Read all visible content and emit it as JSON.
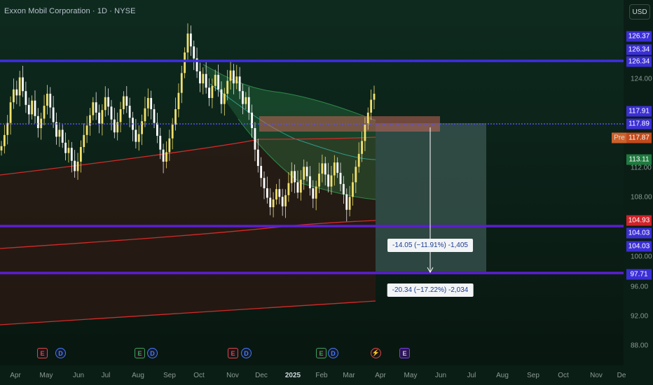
{
  "header": {
    "title": "Exxon Mobil Corporation · 1D · NYSE",
    "currency_button": "USD"
  },
  "price_axis": {
    "ticks": [
      "124.00",
      "112.00",
      "108.00",
      "100.00",
      "96.00",
      "92.00",
      "88.00"
    ],
    "tags": [
      {
        "label": "126.37",
        "color": "#3b2fd6"
      },
      {
        "label": "126.34",
        "color": "#3b2fd6"
      },
      {
        "label": "126.34",
        "color": "#3b2fd6"
      },
      {
        "label": "117.91",
        "color": "#3b2fd6"
      },
      {
        "label": "117.89",
        "color": "#3b2fd6"
      },
      {
        "label": "117.87",
        "color": "#c24a1b"
      },
      {
        "label": "113.11",
        "color": "#1f7a3f"
      },
      {
        "label": "104.93",
        "color": "#d0232a"
      },
      {
        "label": "104.03",
        "color": "#3b2fd6"
      },
      {
        "label": "104.03",
        "color": "#3b2fd6"
      },
      {
        "label": "97.71",
        "color": "#3b2fd6"
      }
    ],
    "pre_label": "Pre"
  },
  "time_axis": {
    "ticks": [
      "Apr",
      "May",
      "Jun",
      "Jul",
      "Aug",
      "Sep",
      "Oct",
      "Nov",
      "Dec",
      "2025",
      "Feb",
      "Mar",
      "Apr",
      "May",
      "Jun",
      "Jul",
      "Aug",
      "Sep",
      "Oct",
      "Nov",
      "De"
    ]
  },
  "measurements": [
    {
      "label": "-14.05 (−11.91%) -1,405"
    },
    {
      "label": "-20.34 (−17.22%) -2,034"
    }
  ],
  "events": [
    {
      "type": "earnings",
      "glyph": "E"
    },
    {
      "type": "dividend",
      "glyph": "D"
    },
    {
      "type": "earnings",
      "glyph": "E"
    },
    {
      "type": "dividend",
      "glyph": "D"
    },
    {
      "type": "earnings",
      "glyph": "E"
    },
    {
      "type": "dividend",
      "glyph": "D"
    },
    {
      "type": "earnings",
      "glyph": "E"
    },
    {
      "type": "dividend",
      "glyph": "D"
    },
    {
      "type": "split",
      "glyph": "⚡"
    },
    {
      "type": "earnings-upcoming",
      "glyph": "E"
    }
  ],
  "colors": {
    "support_line": "#5b1fd1",
    "resistance_line": "#3f2fe0",
    "dotted_line": "#5a4cff",
    "candle": "#f1e06c",
    "ma_red": "#d42a2a",
    "envelope_green": "#2f8a4a"
  },
  "chart_data": {
    "type": "candlestick",
    "price_range": [
      87,
      129.5
    ],
    "horizontal_levels": [
      126.34,
      117.89,
      104.03,
      97.71
    ],
    "close_series": [
      112.5,
      113.8,
      115.2,
      117.6,
      119.1,
      118.4,
      120.5,
      118.9,
      117.3,
      116.2,
      117.8,
      116.0,
      114.6,
      115.7,
      117.2,
      118.6,
      117.0,
      115.3,
      113.6,
      114.4,
      112.9,
      111.7,
      112.3,
      110.8,
      109.6,
      110.7,
      112.4,
      113.8,
      114.9,
      116.1,
      117.6,
      116.4,
      115.1,
      116.7,
      118.2,
      117.1,
      115.6,
      114.1,
      115.3,
      116.8,
      118.3,
      117.2,
      115.8,
      114.4,
      113.0,
      113.9,
      115.4,
      116.9,
      118.1,
      116.8,
      115.2,
      113.7,
      112.1,
      110.7,
      111.8,
      113.4,
      115.0,
      116.8,
      118.7,
      121.0,
      123.4,
      125.6,
      124.1,
      122.7,
      121.2,
      119.8,
      120.9,
      119.3,
      118.1,
      119.5,
      120.8,
      119.1,
      117.4,
      118.6,
      120.1,
      121.3,
      119.8,
      120.6,
      118.9,
      117.4,
      118.2,
      116.4,
      114.6,
      112.1,
      110.2,
      108.8,
      107.6,
      106.5,
      105.4,
      106.3,
      107.5,
      106.6,
      105.5,
      106.8,
      108.2,
      109.6,
      108.3,
      107.1,
      108.6,
      110.1,
      109.0,
      107.6,
      106.4,
      107.8,
      109.3,
      110.5,
      109.2,
      107.8,
      109.1,
      110.6,
      109.4,
      108.1,
      106.9,
      105.1,
      106.6,
      108.3,
      110.1,
      111.6,
      113.1,
      115.0,
      116.4,
      117.9,
      118.6
    ]
  }
}
